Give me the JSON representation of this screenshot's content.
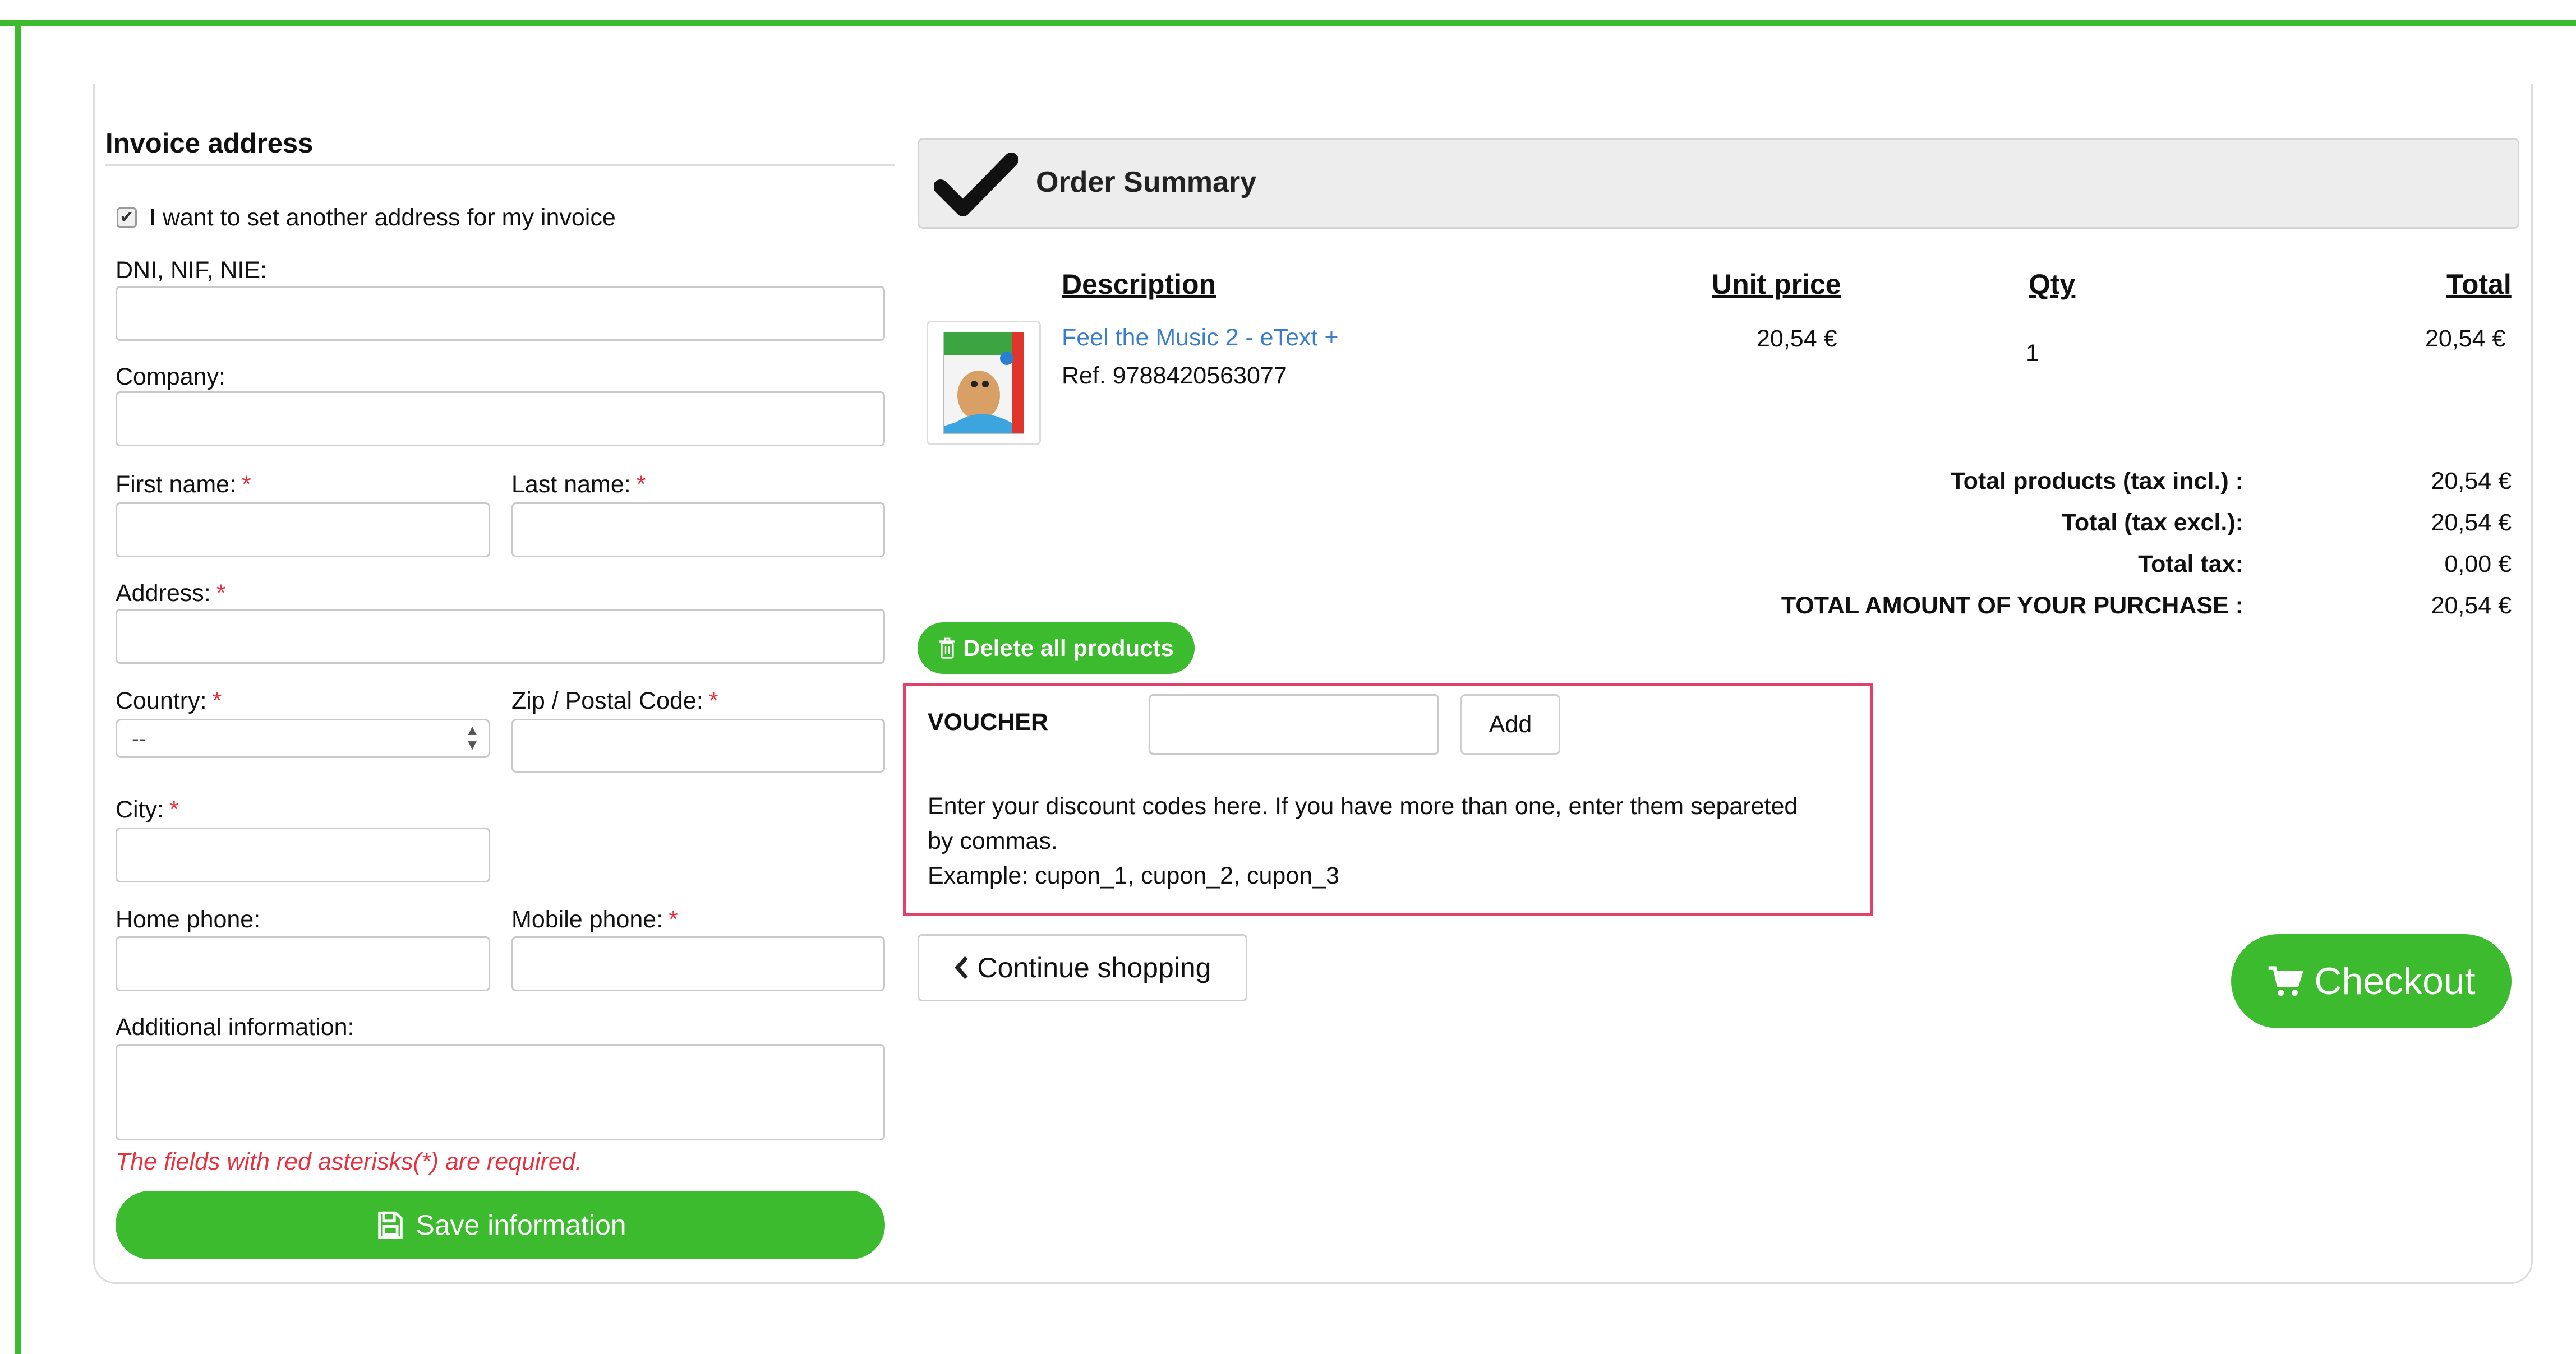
{
  "invoice": {
    "title": "Invoice address",
    "checkbox_label": "I want to set another address for my invoice",
    "labels": {
      "dni": "DNI, NIF, NIE:",
      "company": "Company:",
      "first_name": "First name:",
      "last_name": "Last name:",
      "address": "Address:",
      "country": "Country:",
      "zip": "Zip / Postal Code:",
      "city": "City:",
      "home_phone": "Home phone:",
      "mobile_phone": "Mobile phone:",
      "additional_info": "Additional information:"
    },
    "required_mark": "*",
    "country_value": "--",
    "required_note": "The fields with red asterisks(*) are required.",
    "save_label": "Save information"
  },
  "summary": {
    "title": "Order Summary",
    "columns": {
      "description": "Description",
      "unit_price": "Unit price",
      "qty": "Qty",
      "total": "Total"
    },
    "item": {
      "name": "Feel the Music 2 - eText +",
      "ref": "Ref. 9788420563077",
      "unit_price": "20,54 €",
      "qty": "1",
      "total": "20,54 €"
    },
    "totals": [
      {
        "label": "Total products  (tax incl.) :",
        "value": "20,54 €"
      },
      {
        "label": "Total  (tax excl.):",
        "value": "20,54 €"
      },
      {
        "label": "Total tax:",
        "value": "0,00 €"
      },
      {
        "label": "TOTAL AMOUNT OF YOUR PURCHASE :",
        "value": "20,54 €"
      }
    ],
    "delete_all_label": "Delete all products"
  },
  "voucher": {
    "label": "VOUCHER",
    "input_value": "",
    "add_label": "Add",
    "help_line1": "Enter your discount codes here. If you have more than one, enter them separeted",
    "help_line2": "by commas.",
    "help_line3": "Example: cupon_1, cupon_2, cupon_3"
  },
  "actions": {
    "continue_label": "Continue shopping",
    "checkout_label": "Checkout"
  },
  "colors": {
    "brand_green": "#3dbb2e",
    "required_red": "#e8303e",
    "voucher_border": "#e2416a",
    "link_blue": "#3a7dc9"
  }
}
